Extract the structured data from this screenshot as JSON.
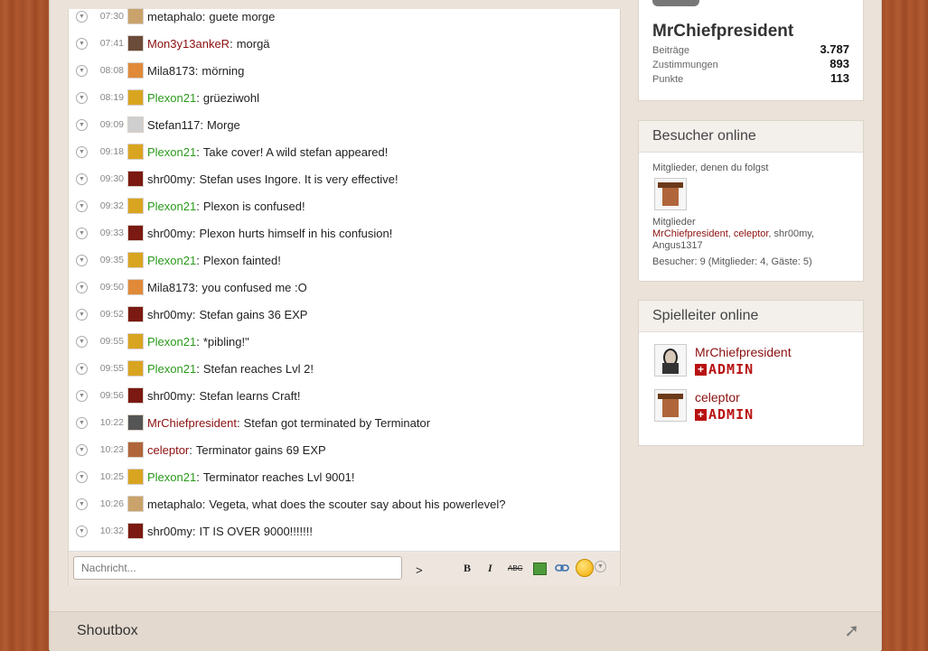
{
  "chat": {
    "messages": [
      {
        "time": "07:30",
        "user": "metaphalo",
        "text": "guete morge",
        "color": "#222222",
        "avatar_color": "#c9a36b"
      },
      {
        "time": "07:41",
        "user": "Mon3y13ankeR",
        "text": "morgä",
        "color": "#8b0f0f",
        "avatar_color": "#6b4b3a"
      },
      {
        "time": "08:08",
        "user": "Mila8173",
        "text": "mörning",
        "color": "#222222",
        "avatar_color": "#e08a3a"
      },
      {
        "time": "08:19",
        "user": "Plexon21",
        "text": "grüeziwohl",
        "color": "#2a9a1a",
        "avatar_color": "#d9a520"
      },
      {
        "time": "09:09",
        "user": "Stefan117",
        "text": "Morge",
        "color": "#222222",
        "avatar_color": "#cfcfcf"
      },
      {
        "time": "09:18",
        "user": "Plexon21",
        "text": "Take cover! A wild stefan appeared!",
        "color": "#2a9a1a",
        "avatar_color": "#d9a520"
      },
      {
        "time": "09:30",
        "user": "shr00my",
        "text": "Stefan uses Ingore. It is very effective!",
        "color": "#222222",
        "avatar_color": "#7a1a12"
      },
      {
        "time": "09:32",
        "user": "Plexon21",
        "text": "Plexon is confused!",
        "color": "#2a9a1a",
        "avatar_color": "#d9a520"
      },
      {
        "time": "09:33",
        "user": "shr00my",
        "text": "Plexon hurts himself in his confusion!",
        "color": "#222222",
        "avatar_color": "#7a1a12"
      },
      {
        "time": "09:35",
        "user": "Plexon21",
        "text": "Plexon fainted!",
        "color": "#2a9a1a",
        "avatar_color": "#d9a520"
      },
      {
        "time": "09:50",
        "user": "Mila8173",
        "text": "you confused me :O",
        "color": "#222222",
        "avatar_color": "#e08a3a"
      },
      {
        "time": "09:52",
        "user": "shr00my",
        "text": "Stefan gains 36 EXP",
        "color": "#222222",
        "avatar_color": "#7a1a12"
      },
      {
        "time": "09:55",
        "user": "Plexon21",
        "text": "*pibling!\"",
        "color": "#2a9a1a",
        "avatar_color": "#d9a520"
      },
      {
        "time": "09:55",
        "user": "Plexon21",
        "text": "Stefan reaches Lvl 2!",
        "color": "#2a9a1a",
        "avatar_color": "#d9a520"
      },
      {
        "time": "09:56",
        "user": "shr00my",
        "text": "Stefan learns Craft!",
        "color": "#222222",
        "avatar_color": "#7a1a12"
      },
      {
        "time": "10:22",
        "user": "MrChiefpresident",
        "text": "Stefan got terminated by Terminator",
        "color": "#8b0f0f",
        "avatar_color": "#555555"
      },
      {
        "time": "10:23",
        "user": "celeptor",
        "text": "Terminator gains 69 EXP",
        "color": "#8b0f0f",
        "avatar_color": "#b0663a"
      },
      {
        "time": "10:25",
        "user": "Plexon21",
        "text": "Terminator reaches Lvl 9001!",
        "color": "#2a9a1a",
        "avatar_color": "#d9a520"
      },
      {
        "time": "10:26",
        "user": "metaphalo",
        "text": "Vegeta, what does the scouter say about his powerlevel?",
        "color": "#222222",
        "avatar_color": "#c9a36b"
      },
      {
        "time": "10:32",
        "user": "shr00my",
        "text": "IT IS OVER 9000!!!!!!!",
        "color": "#222222",
        "avatar_color": "#7a1a12"
      }
    ],
    "input_placeholder": "Nachricht...",
    "send_label": ">",
    "toolbar": {
      "bold": "B",
      "italic": "I",
      "strike": "ABC"
    }
  },
  "profile": {
    "name": "MrChiefpresident",
    "stats": [
      {
        "label": "Beiträge",
        "value": "3.787"
      },
      {
        "label": "Zustimmungen",
        "value": "893"
      },
      {
        "label": "Punkte",
        "value": "113"
      }
    ]
  },
  "visitors": {
    "title": "Besucher online",
    "followed_label": "Mitglieder, denen du folgst",
    "members_label": "Mitglieder",
    "members": [
      "MrChiefpresident",
      "celeptor",
      "shr00my",
      "Angus1317"
    ],
    "summary": "Besucher: 9 (Mitglieder: 4, Gäste: 5)"
  },
  "moderators": {
    "title": "Spielleiter online",
    "items": [
      {
        "name": "MrChiefpresident",
        "badge": "ADMIN"
      },
      {
        "name": "celeptor",
        "badge": "ADMIN"
      }
    ]
  },
  "footer": {
    "title": "Shoutbox"
  }
}
